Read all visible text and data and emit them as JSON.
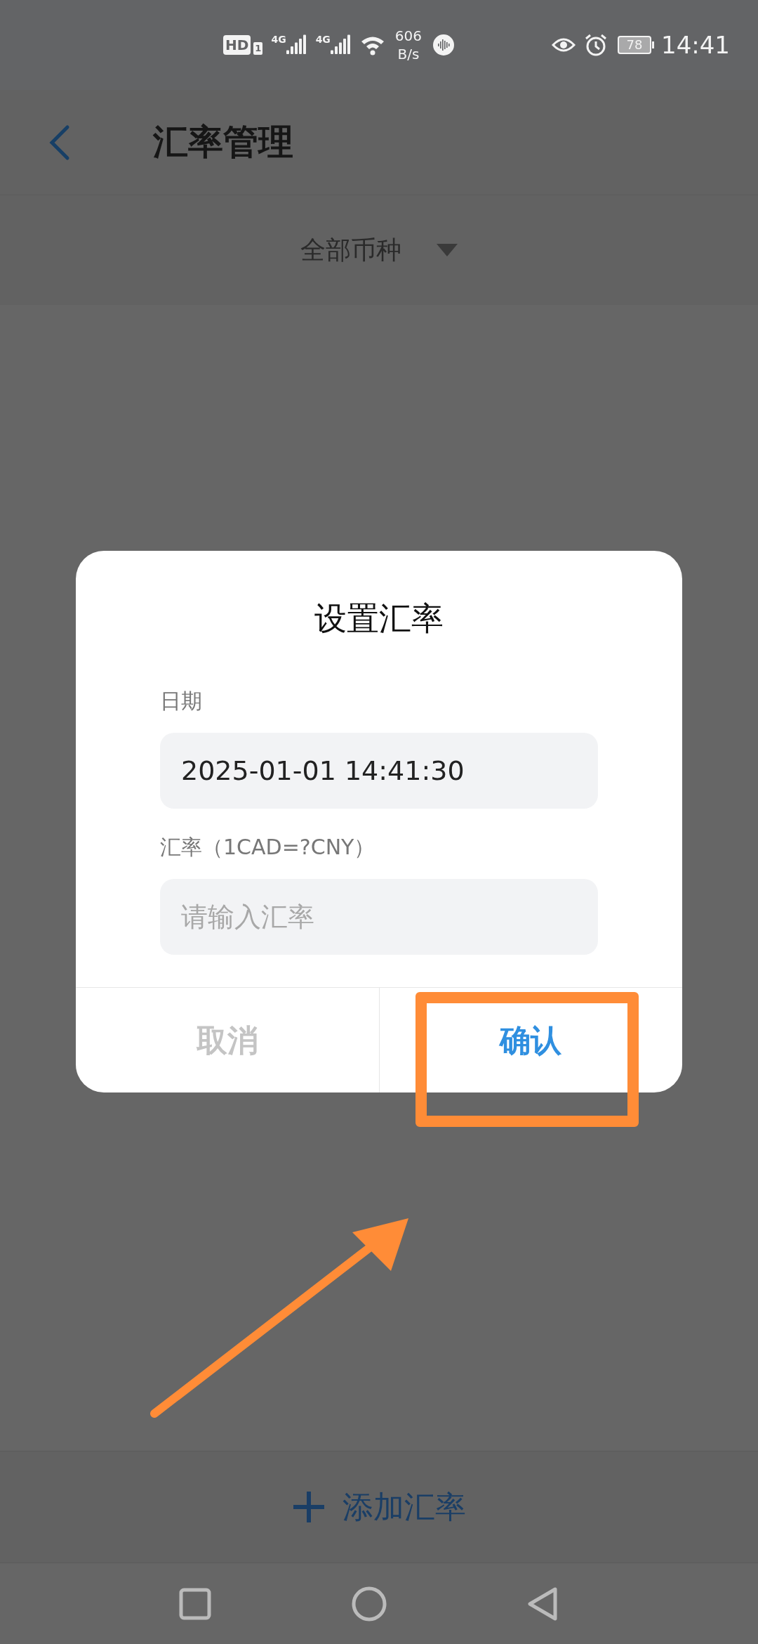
{
  "status_bar": {
    "hd": "HD",
    "sim": "1",
    "networks": [
      "4G",
      "4G"
    ],
    "speed": [
      "606",
      "B/s"
    ],
    "battery": "78",
    "time": "14:41"
  },
  "header": {
    "title": "汇率管理"
  },
  "filter": {
    "label": "全部币种"
  },
  "dialog": {
    "title": "设置汇率",
    "fields": [
      {
        "label": "日期",
        "value": "2025-01-01 14:41:30"
      },
      {
        "label": "汇率（1CAD=?CNY）",
        "placeholder": "请输入汇率"
      }
    ],
    "buttons": [
      {
        "label": "取消",
        "kind": "cancel"
      },
      {
        "label": "确认",
        "kind": "confirm"
      }
    ]
  },
  "add_button": {
    "label": "添加汇率"
  }
}
